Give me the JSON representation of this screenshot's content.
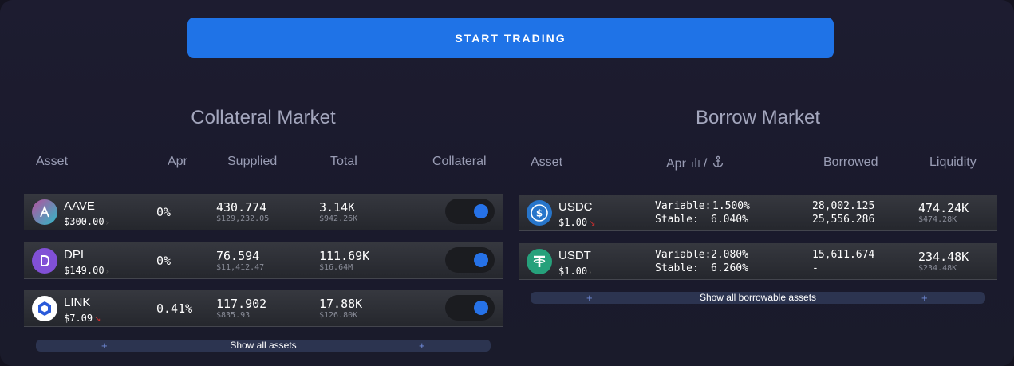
{
  "start_button": "START TRADING",
  "collateral": {
    "title": "Collateral Market",
    "headers": {
      "asset": "Asset",
      "apr": "Apr",
      "supplied": "Supplied",
      "total": "Total",
      "collateral": "Collateral"
    },
    "rows": [
      {
        "symbol": "AAVE",
        "price": "$300.00",
        "apr": "0%",
        "supplied": "430.774",
        "supplied_usd": "$129,232.05",
        "total": "3.14K",
        "total_usd": "$942.26K",
        "collateral_on": true,
        "trend": "neutral"
      },
      {
        "symbol": "DPI",
        "price": "$149.00",
        "apr": "0%",
        "supplied": "76.594",
        "supplied_usd": "$11,412.47",
        "total": "111.69K",
        "total_usd": "$16.64M",
        "collateral_on": true,
        "trend": "neutral"
      },
      {
        "symbol": "LINK",
        "price": "$7.09",
        "apr": "0.41%",
        "supplied": "117.902",
        "supplied_usd": "$835.93",
        "total": "17.88K",
        "total_usd": "$126.80K",
        "collateral_on": true,
        "trend": "down"
      }
    ],
    "show_all": "Show all assets"
  },
  "borrow": {
    "title": "Borrow Market",
    "headers": {
      "asset": "Asset",
      "apr": "Apr",
      "apr_sep": "/",
      "borrowed": "Borrowed",
      "liquidity": "Liquidity"
    },
    "rows": [
      {
        "symbol": "USDC",
        "price": "$1.00",
        "variable_label": "Variable:",
        "variable": "1.500%",
        "stable_label": "Stable:",
        "stable": "6.040%",
        "borrowed_var": "28,002.125",
        "borrowed_stable": "25,556.286",
        "liquidity": "474.24K",
        "liquidity_usd": "$474.28K",
        "trend": "down"
      },
      {
        "symbol": "USDT",
        "price": "$1.00",
        "variable_label": "Variable:",
        "variable": "2.080%",
        "stable_label": "Stable:",
        "stable": "6.260%",
        "borrowed_var": "15,611.674",
        "borrowed_stable": "-",
        "liquidity": "234.48K",
        "liquidity_usd": "$234.48K",
        "trend": "neutral"
      }
    ],
    "show_all": "Show all borrowable assets"
  },
  "colors": {
    "accent": "#1f73e7",
    "toggle_knob": "#2672e8",
    "down": "#e02f2f"
  }
}
